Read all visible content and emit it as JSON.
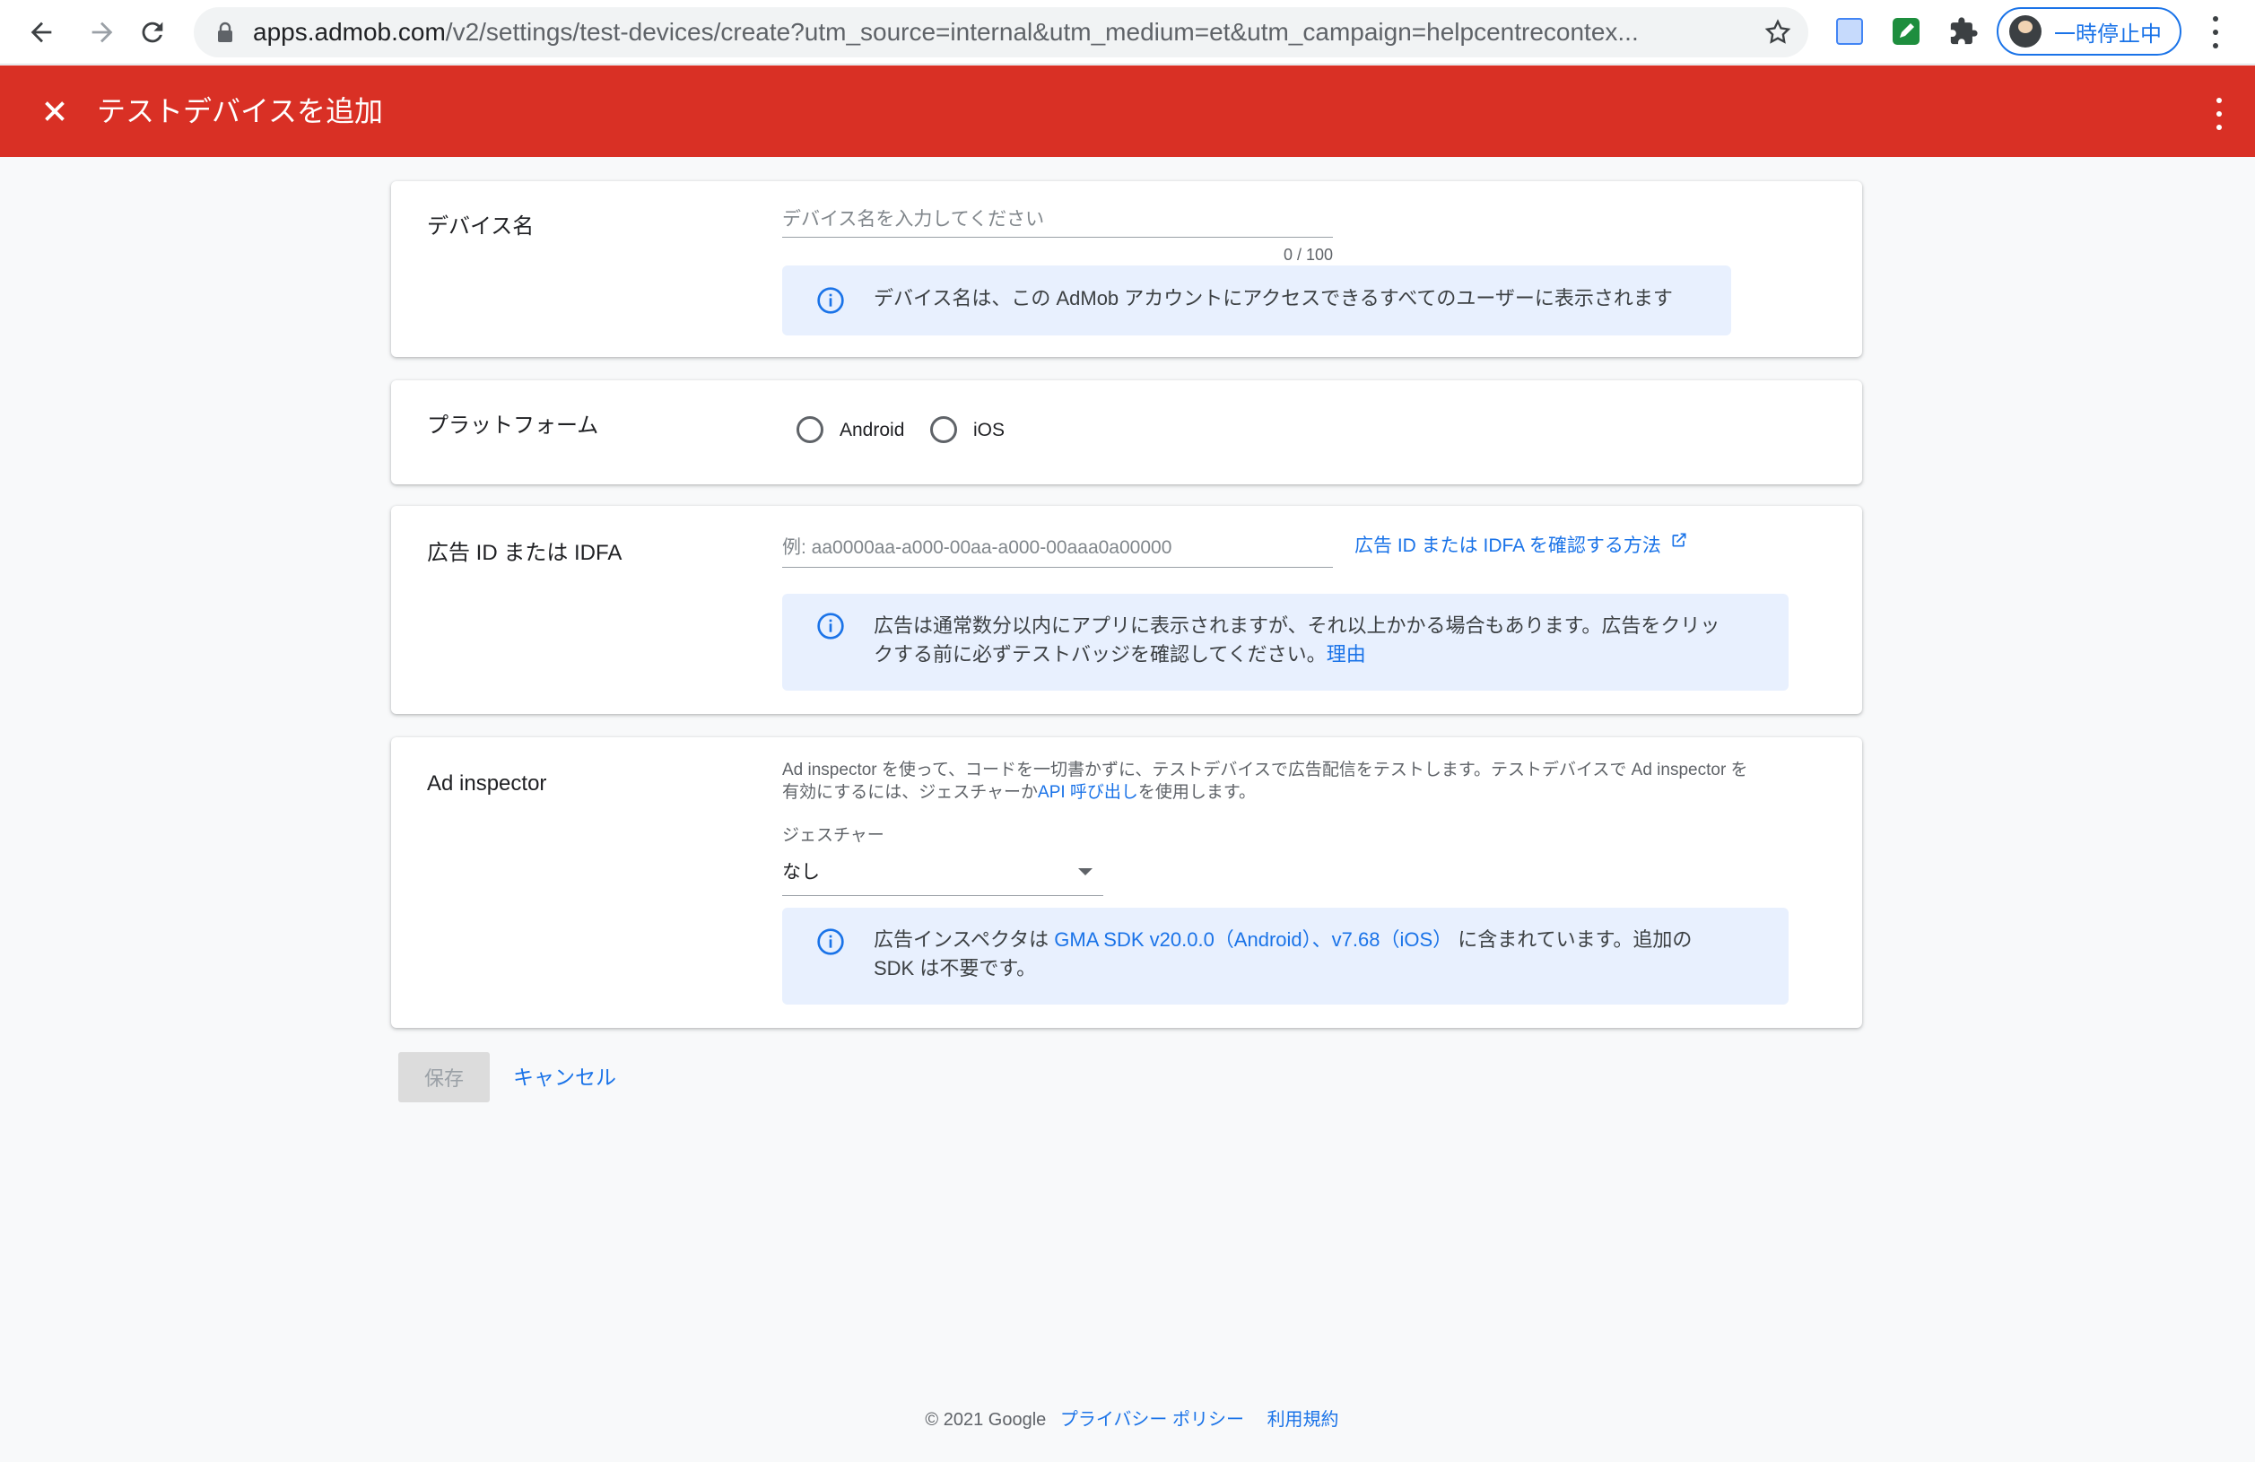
{
  "browser": {
    "url_host": "apps.admob.com",
    "url_path": "/v2/settings/test-devices/create?utm_source=internal&utm_medium=et&utm_campaign=helpcentrecontex...",
    "profile_label": "一時停止中"
  },
  "appbar": {
    "title": "テストデバイスを追加"
  },
  "device_name": {
    "label": "デバイス名",
    "placeholder": "デバイス名を入力してください",
    "counter": "0 / 100",
    "info": "デバイス名は、この AdMob アカウントにアクセスできるすべてのユーザーに表示されます"
  },
  "platform": {
    "label": "プラットフォーム",
    "options": [
      "Android",
      "iOS"
    ]
  },
  "ad_id": {
    "label": "広告 ID または IDFA",
    "placeholder": "例: aa0000aa-a000-00aa-a000-00aaa0a00000",
    "help_link": "広告 ID または IDFA を確認する方法",
    "info_line1": "広告は通常数分以内にアプリに表示されますが、それ以上かかる場合もあります。広告をクリッ",
    "info_line2": "クする前に必ずテストバッジを確認してください。",
    "info_link": "理由"
  },
  "ad_inspector": {
    "label": "Ad inspector",
    "desc_line1": "Ad inspector を使って、コードを一切書かずに、テストデバイスで広告配信をテストします。テストデバイスで Ad inspector を",
    "desc_line2_pre": "有効にするには、ジェスチャーか",
    "desc_link": "API 呼び出し",
    "desc_line2_post": "を使用します。",
    "gesture_label": "ジェスチャー",
    "gesture_value": "なし",
    "info_pre": "広告インスペクタは",
    "info_link": "GMA SDK v20.0.0（Android）、v7.68（iOS）",
    "info_post": "に含まれています。追加の",
    "info_line2": "SDK は不要です。"
  },
  "actions": {
    "save": "保存",
    "cancel": "キャンセル"
  },
  "footer": {
    "copyright": "© 2021 Google",
    "privacy": "プライバシー ポリシー",
    "terms": "利用規約"
  },
  "colors": {
    "appbar": "#d93025",
    "link": "#1a73e8",
    "info_bg": "#e8f0fe"
  }
}
